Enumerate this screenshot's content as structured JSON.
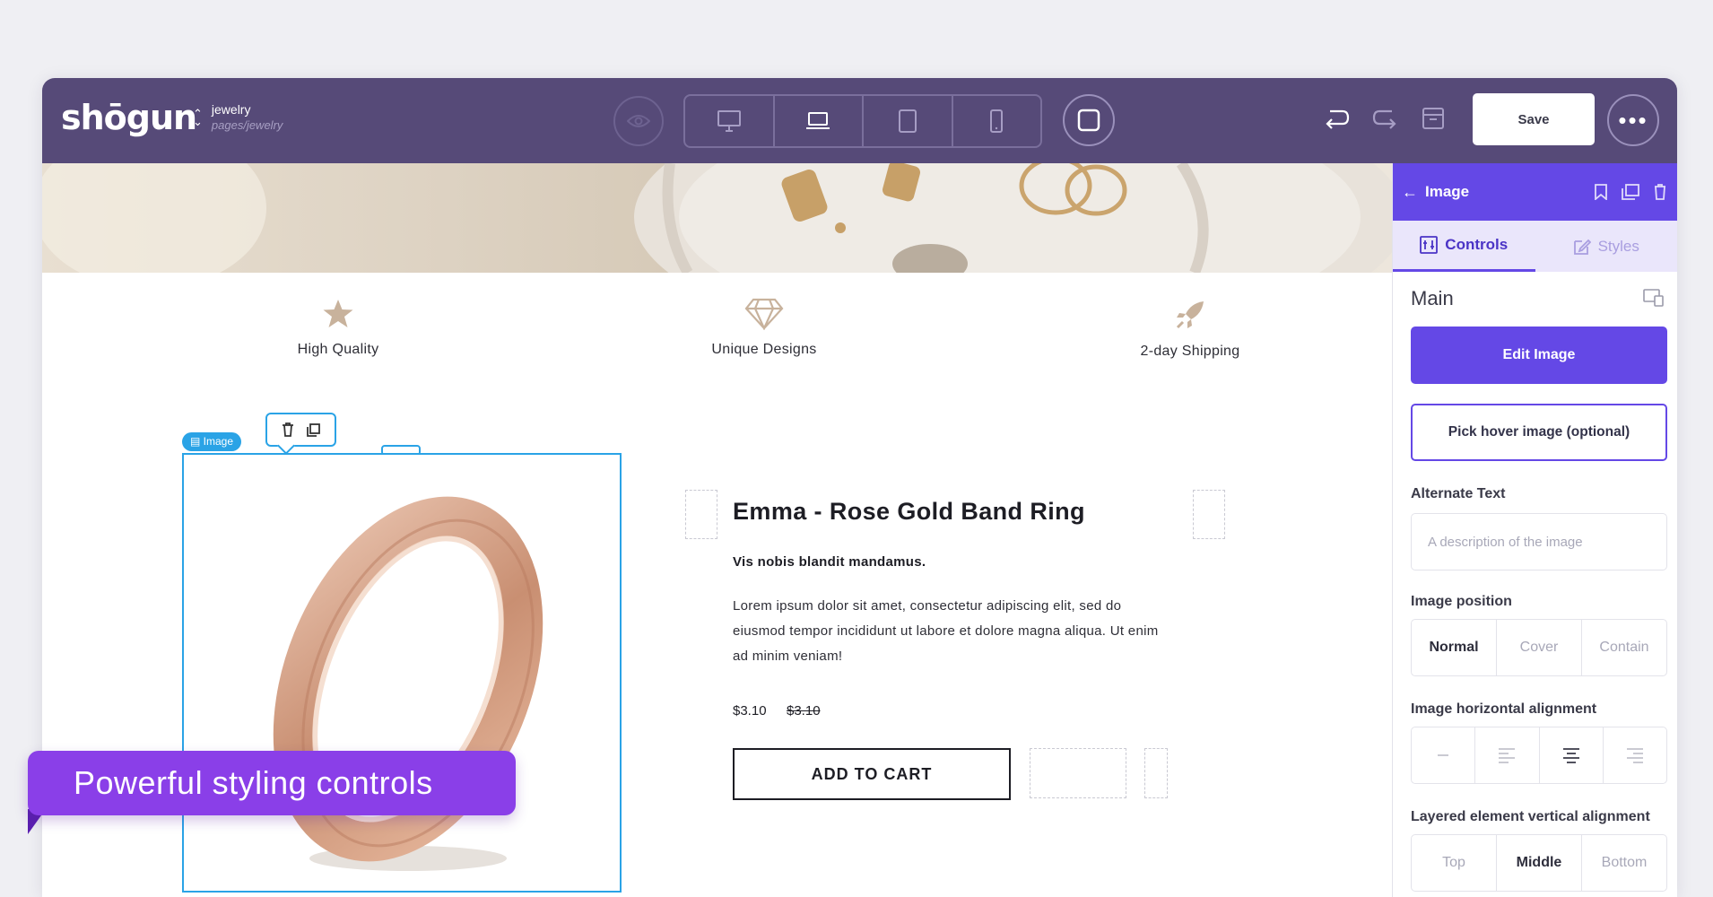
{
  "app": {
    "logo": "shōgun",
    "page_name": "jewelry",
    "page_path": "pages/jewelry"
  },
  "toolbar": {
    "save_label": "Save",
    "more_label": "•••",
    "devices": [
      "desktop-icon",
      "laptop-icon",
      "tablet-icon",
      "mobile-icon"
    ]
  },
  "features": [
    {
      "icon": "star-icon",
      "label": "High Quality"
    },
    {
      "icon": "diamond-icon",
      "label": "Unique Designs"
    },
    {
      "icon": "rocket-icon",
      "label": "2-day Shipping"
    }
  ],
  "selection": {
    "badge": "▤ Image"
  },
  "product": {
    "title": "Emma - Rose Gold Band Ring",
    "subtitle": "Vis nobis blandit mandamus.",
    "description": "Lorem ipsum dolor sit amet, consectetur adipiscing elit, sed do eiusmod tempor incididunt ut labore et dolore magna aliqua. Ut enim ad minim veniam!",
    "price": "$3.10",
    "compare_price": "$3.10",
    "cart_label": "ADD TO CART"
  },
  "panel": {
    "title": "Image",
    "tabs": [
      {
        "label": "Controls",
        "active": true
      },
      {
        "label": "Styles",
        "active": false
      }
    ],
    "section": "Main",
    "edit_image": "Edit Image",
    "hover_image": "Pick hover image (optional)",
    "alt_text_label": "Alternate Text",
    "alt_text_placeholder": "A description of the image",
    "alt_text_value": "",
    "position_label": "Image position",
    "position_options": [
      "Normal",
      "Cover",
      "Contain"
    ],
    "position_selected": "Normal",
    "halign_label": "Image horizontal alignment",
    "halign_options": [
      "none-icon",
      "align-left-icon",
      "align-center-icon",
      "align-right-icon"
    ],
    "halign_selected": "align-center-icon",
    "valign_label": "Layered element vertical alignment",
    "valign_options": [
      "Top",
      "Middle",
      "Bottom"
    ],
    "valign_selected": "Middle"
  },
  "caption": "Powerful styling controls",
  "colors": {
    "topbar": "#564a78",
    "accent": "#6448e6",
    "selection": "#2aa3e6",
    "caption": "#8a3fe8"
  }
}
